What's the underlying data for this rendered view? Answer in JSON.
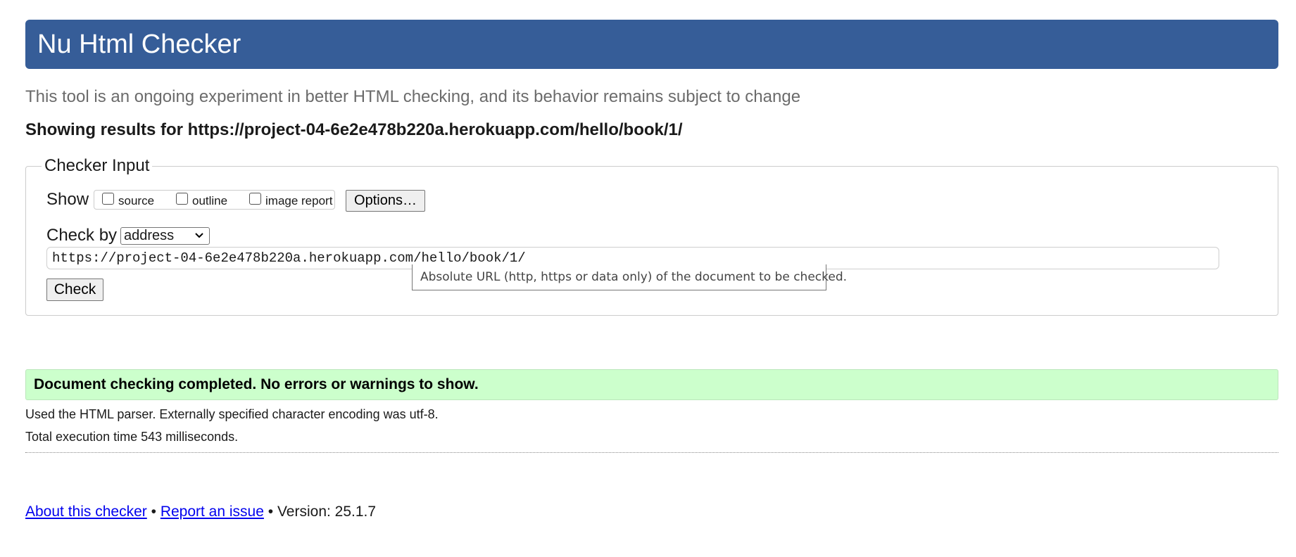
{
  "header": {
    "title": "Nu Html Checker"
  },
  "subtitle": "This tool is an ongoing experiment in better HTML checking, and its behavior remains subject to change",
  "results_heading": "Showing results for https://project-04-6e2e478b220a.herokuapp.com/hello/book/1/",
  "checker_input": {
    "legend": "Checker Input",
    "show_label": "Show",
    "options": [
      {
        "label": "source",
        "checked": false
      },
      {
        "label": "outline",
        "checked": false
      },
      {
        "label": "image report",
        "checked": false
      }
    ],
    "options_button": "Options…",
    "check_by_label": "Check by",
    "check_by_selected": "address",
    "url_value": "https://project-04-6e2e478b220a.herokuapp.com/hello/book/1/",
    "tooltip": "Absolute URL (http, https or data only) of the document to be checked.",
    "check_button": "Check"
  },
  "result": {
    "status_message": "Document checking completed. No errors or warnings to show.",
    "status_color": "#ccffcc",
    "parser_info": "Used the HTML parser. Externally specified character encoding was utf-8.",
    "execution_time": "Total execution time 543 milliseconds."
  },
  "footer": {
    "about_link": "About this checker",
    "separator": "•",
    "report_link": "Report an issue",
    "version": "Version: 25.1.7"
  },
  "colors": {
    "title_bar": "#365d98",
    "link": "#0000ee"
  },
  "icons": {
    "select_arrow": "chevron-down-icon"
  }
}
